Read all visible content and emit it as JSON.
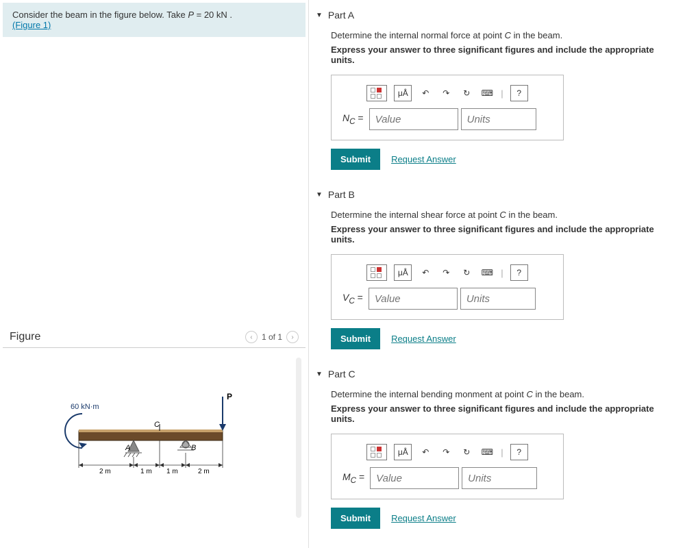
{
  "problem": {
    "intro": "Consider the beam in the figure below. Take ",
    "var": "P",
    "eq": " = 20 kN .",
    "figlink": "(Figure 1)"
  },
  "figure": {
    "title": "Figure",
    "pager": "1 of 1",
    "labels": {
      "moment": "60 kN·m",
      "P": "P",
      "A": "A",
      "B": "B",
      "C": "C",
      "d1": "2 m",
      "d2": "1 m",
      "d3": "1 m",
      "d4": "2 m"
    }
  },
  "parts": [
    {
      "title": "Part A",
      "prompt_pre": "Determine the internal normal force at point ",
      "prompt_var": "C",
      "prompt_post": " in the beam.",
      "instr": "Express your answer to three significant figures and include the appropriate units.",
      "symbol": "N",
      "sub": "C"
    },
    {
      "title": "Part B",
      "prompt_pre": "Determine the internal shear force at point ",
      "prompt_var": "C",
      "prompt_post": " in the beam.",
      "instr": "Express your answer to three significant figures and include the appropriate units.",
      "symbol": "V",
      "sub": "C"
    },
    {
      "title": "Part C",
      "prompt_pre": "Determine the internal bending monment at point ",
      "prompt_var": "C",
      "prompt_post": " in the beam.",
      "instr": "Express your answer to three significant figures and include the appropriate units.",
      "symbol": "M",
      "sub": "C"
    }
  ],
  "common": {
    "value_ph": "Value",
    "units_ph": "Units",
    "submit": "Submit",
    "request": "Request Answer",
    "mu": "μÅ",
    "help": "?",
    "eq_sign": " = "
  }
}
